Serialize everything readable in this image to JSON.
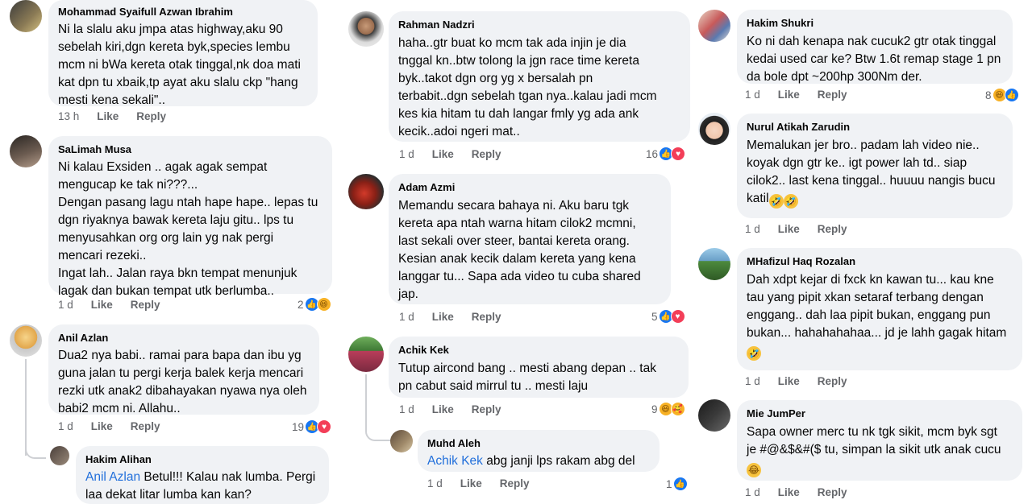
{
  "comments": {
    "c1": {
      "author": "Mohammad Syaifull Azwan Ibrahim",
      "text": "Ni la slalu aku jmpa atas highway,aku 90\nsebelah kiri,dgn kereta byk,species lembu\nmcm ni bWa kereta otak tinggal,nk doa mati\nkat dpn tu xbaik,tp ayat aku slalu ckp \"hang\nmesti kena sekali\"..",
      "time": "13 h",
      "like": "Like",
      "reply": "Reply"
    },
    "c2": {
      "author": "SaLimah Musa",
      "text": "Ni kalau Exsiden .. agak agak sempat\nmengucap ke tak ni???...\nDengan pasang lagu ntah hape hape.. lepas tu\ndgn riyaknya bawak kereta laju gitu.. lps tu\nmenyusahkan org org lain yg nak pergi\nmencari rezeki..\nIngat lah.. Jalan raya bkn tempat menunjuk\nlagak dan bukan tempat utk berlumba..",
      "time": "1 d",
      "like": "Like",
      "reply": "Reply",
      "reactions": "2"
    },
    "c3": {
      "author": "Anil Azlan",
      "text": "Dua2 nya babi.. ramai para bapa dan ibu yg\nguna jalan tu pergi kerja balek kerja mencari\nrezki utk anak2 dibahayakan nyawa nya oleh\nbabi2 mcm ni. Allahu..",
      "time": "1 d",
      "like": "Like",
      "reply": "Reply",
      "reactions": "19"
    },
    "c3r": {
      "author": "Hakim Alihan",
      "mention": "Anil Azlan",
      "text": " Betul!!! Kalau nak lumba. Pergi\nlaa dekat litar lumba kan kan?"
    },
    "c4": {
      "author": "Rahman Nadzri",
      "text": "haha..gtr buat ko mcm tak ada injin je dia\ntnggal kn..btw tolong la jgn race time kereta\nbyk..takot dgn org yg x bersalah pn\nterbabit..dgn sebelah tgan nya..kalau jadi mcm\nkes kia hitam tu dah langar fmly yg ada ank\nkecik..adoi ngeri mat..",
      "time": "1 d",
      "like": "Like",
      "reply": "Reply",
      "reactions": "16"
    },
    "c5": {
      "author": "Adam Azmi",
      "text": "Memandu secara bahaya ni. Aku baru tgk\nkereta apa ntah warna hitam cilok2 mcmni,\nlast sekali over steer, bantai kereta orang.\nKesian anak kecik dalam kereta yang kena\nlanggar tu... Sapa ada video tu cuba shared\njap.",
      "time": "1 d",
      "like": "Like",
      "reply": "Reply",
      "reactions": "5"
    },
    "c6": {
      "author": "Achik Kek",
      "text": "Tutup aircond bang .. mesti abang depan .. tak\npn cabut said mirrul tu .. mesti laju",
      "time": "1 d",
      "like": "Like",
      "reply": "Reply",
      "reactions": "9"
    },
    "c6r": {
      "author": "Muhd Aleh",
      "mention": "Achik Kek",
      "text": " abg janji lps rakam abg del",
      "time": "1 d",
      "like": "Like",
      "reply": "Reply",
      "reactions": "1"
    },
    "c7": {
      "author": "Hakim Shukri",
      "text": "Ko ni dah kenapa nak cucuk2 gtr otak tinggal\nkedai used car ke? Btw 1.6t remap stage 1 pn\nda bole dpt ~200hp 300Nm der.",
      "time": "1 d",
      "like": "Like",
      "reply": "Reply",
      "reactions": "8"
    },
    "c8": {
      "author": "Nurul Atikah Zarudin",
      "text": "Memalukan jer bro.. padam lah video nie..\nkoyak dgn gtr ke.. igt power lah td.. siap\ncilok2.. last kena tinggal.. huuuu nangis bucu\nkatil",
      "time": "1 d",
      "like": "Like",
      "reply": "Reply"
    },
    "c9": {
      "author": "MHafizul Haq Rozalan",
      "text": "Dah xdpt kejar di fxck kn kawan tu... kau kne\ntau yang pipit xkan setaraf terbang dengan\nenggang.. dah laa pipit bukan, enggang pun\nbukan... hahahahahaa... jd je lahh gagak hitam",
      "time": "1 d",
      "like": "Like",
      "reply": "Reply"
    },
    "c10": {
      "author": "Mie JumPer",
      "text": "Sapa owner merc tu nk tgk sikit, mcm byk sgt\nje #@&$&#($ tu, simpan la sikit utk anak cucu",
      "time": "1 d",
      "like": "Like",
      "reply": "Reply"
    }
  },
  "colors": {
    "bubble": "#f0f2f5",
    "mention": "#216fdb",
    "meta": "#65676b",
    "like": "#1877f2",
    "love": "#f33e58",
    "haha": "#f7b125"
  },
  "icons": [
    "like-reaction-icon",
    "love-reaction-icon",
    "haha-reaction-icon",
    "rofl-emoji-icon",
    "laughing-emoji-icon"
  ]
}
